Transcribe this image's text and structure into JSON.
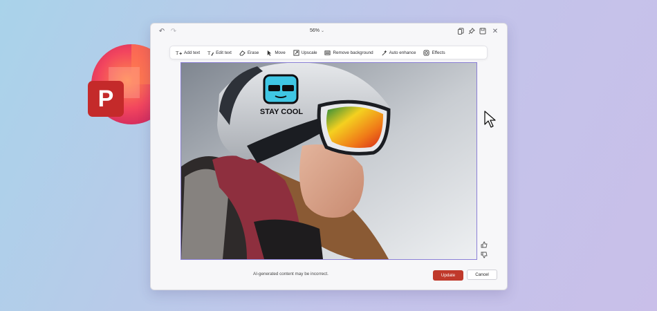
{
  "app": {
    "name": "PowerPoint",
    "logo_letter": "P"
  },
  "titlebar": {
    "zoom_label": "56%"
  },
  "toolbar": {
    "tools": [
      {
        "label": "Add text",
        "icon": "add-text-icon"
      },
      {
        "label": "Edit text",
        "icon": "edit-text-icon"
      },
      {
        "label": "Erase",
        "icon": "eraser-icon"
      },
      {
        "label": "Move",
        "icon": "move-icon"
      },
      {
        "label": "Upscale",
        "icon": "upscale-icon"
      },
      {
        "label": "Remove background",
        "icon": "remove-background-icon"
      },
      {
        "label": "Auto enhance",
        "icon": "sparkle-icon"
      },
      {
        "label": "Effects",
        "icon": "effects-icon"
      }
    ]
  },
  "image": {
    "sticker_text": "STAY COOL"
  },
  "footer": {
    "disclaimer": "AI-generated content may be incorrect.",
    "update_label": "Update",
    "cancel_label": "Cancel"
  },
  "colors": {
    "accent": "#c0392b",
    "selection_border": "#8a7fd6"
  }
}
